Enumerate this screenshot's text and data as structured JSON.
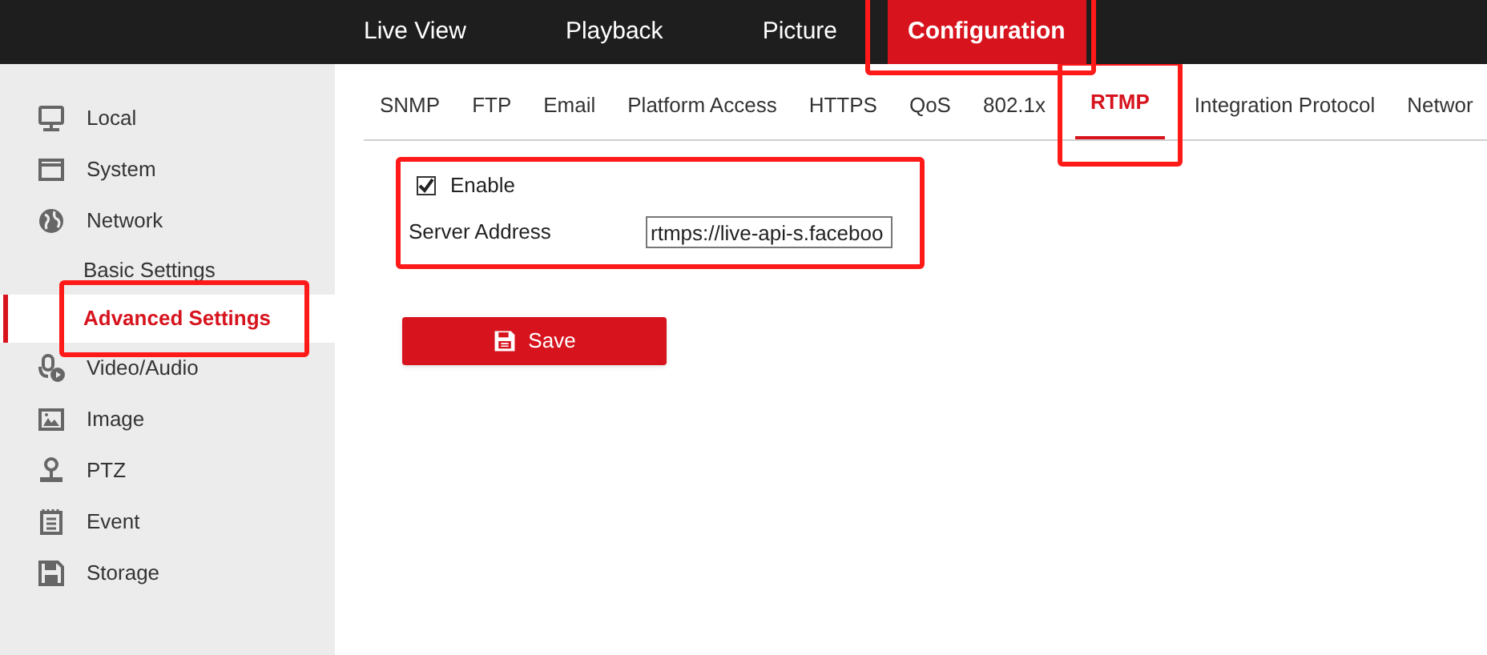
{
  "nav": [
    {
      "label": "Live View",
      "selected": false,
      "highlighted": false
    },
    {
      "label": "Playback",
      "selected": false,
      "highlighted": false
    },
    {
      "label": "Picture",
      "selected": false,
      "highlighted": false
    },
    {
      "label": "Configuration",
      "selected": true,
      "highlighted": true
    }
  ],
  "sidebar": {
    "items": [
      {
        "label": "Local",
        "kind": "monitor",
        "selected": false,
        "highlighted": false
      },
      {
        "label": "System",
        "kind": "window",
        "selected": false,
        "highlighted": false
      },
      {
        "label": "Network",
        "kind": "globe",
        "selected": false,
        "highlighted": false,
        "children": [
          {
            "label": "Basic Settings",
            "selected": false,
            "highlighted": false
          },
          {
            "label": "Advanced Settings",
            "selected": true,
            "highlighted": true
          }
        ]
      },
      {
        "label": "Video/Audio",
        "kind": "mic",
        "selected": false,
        "highlighted": false
      },
      {
        "label": "Image",
        "kind": "image",
        "selected": false,
        "highlighted": false
      },
      {
        "label": "PTZ",
        "kind": "joystick",
        "selected": false,
        "highlighted": false
      },
      {
        "label": "Event",
        "kind": "list",
        "selected": false,
        "highlighted": false
      },
      {
        "label": "Storage",
        "kind": "disk",
        "selected": false,
        "highlighted": false
      }
    ]
  },
  "tabs": [
    {
      "label": "SNMP",
      "selected": false,
      "highlighted": false
    },
    {
      "label": "FTP",
      "selected": false,
      "highlighted": false
    },
    {
      "label": "Email",
      "selected": false,
      "highlighted": false
    },
    {
      "label": "Platform Access",
      "selected": false,
      "highlighted": false
    },
    {
      "label": "HTTPS",
      "selected": false,
      "highlighted": false
    },
    {
      "label": "QoS",
      "selected": false,
      "highlighted": false
    },
    {
      "label": "802.1x",
      "selected": false,
      "highlighted": false
    },
    {
      "label": "RTMP",
      "selected": true,
      "highlighted": true
    },
    {
      "label": "Integration Protocol",
      "selected": false,
      "highlighted": false
    },
    {
      "label": "Networ",
      "selected": false,
      "highlighted": false
    }
  ],
  "form": {
    "highlighted": true,
    "enable": {
      "label": "Enable",
      "checked": true
    },
    "server_address": {
      "label": "Server Address",
      "value": "rtmps://live-api-s.faceboo"
    }
  },
  "save_button": {
    "label": "Save"
  }
}
